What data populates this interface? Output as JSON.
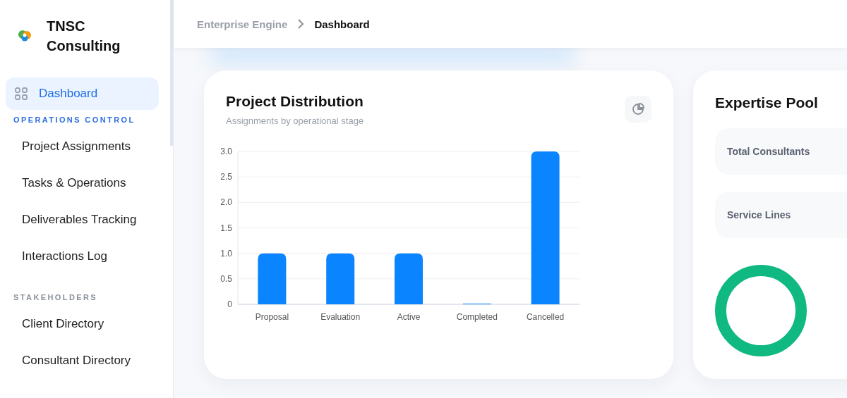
{
  "brand": {
    "name": "TNSC Consulting"
  },
  "sidebar": {
    "items": [
      {
        "label": "Dashboard",
        "selected": true,
        "kind": "top"
      }
    ],
    "sections": [
      {
        "heading": "OPERATIONS CONTROL",
        "items": [
          {
            "label": "Project Assignments",
            "selected": false
          },
          {
            "label": "Tasks & Operations",
            "selected": false
          },
          {
            "label": "Deliverables Tracking",
            "selected": false
          },
          {
            "label": "Interactions Log",
            "selected": false
          }
        ]
      },
      {
        "heading": "STAKEHOLDERS",
        "items": [
          {
            "label": "Client Directory",
            "selected": false
          },
          {
            "label": "Consultant Directory",
            "selected": false
          }
        ]
      }
    ]
  },
  "breadcrumb": [
    {
      "label": "Enterprise Engine",
      "selected": false
    },
    {
      "label": "Dashboard",
      "selected": true
    }
  ],
  "project_card": {
    "title": "Project Distribution",
    "subtitle": "Assignments by operational stage",
    "chart_data": {
      "type": "bar",
      "categories": [
        "Proposal",
        "Evaluation",
        "Active",
        "Completed",
        "Cancelled"
      ],
      "series": [
        {
          "color": "#0a84ff",
          "values": [
            1,
            1,
            1,
            0,
            3
          ]
        }
      ],
      "grid": true,
      "ylim": [
        0,
        3
      ],
      "yticks": [
        {
          "value": 0,
          "label": "0"
        },
        {
          "value": 0.5,
          "label": "0.5"
        },
        {
          "value": 1,
          "label": "1.0"
        },
        {
          "value": 1.5,
          "label": "1.5"
        },
        {
          "value": 2,
          "label": "2.0"
        },
        {
          "value": 2.5,
          "label": "2.5"
        },
        {
          "value": 3,
          "label": "3.0"
        }
      ]
    }
  },
  "expertise_card": {
    "title": "Expertise Pool",
    "stats": [
      {
        "label": "Total Consultants"
      },
      {
        "label": "Service Lines"
      }
    ]
  }
}
